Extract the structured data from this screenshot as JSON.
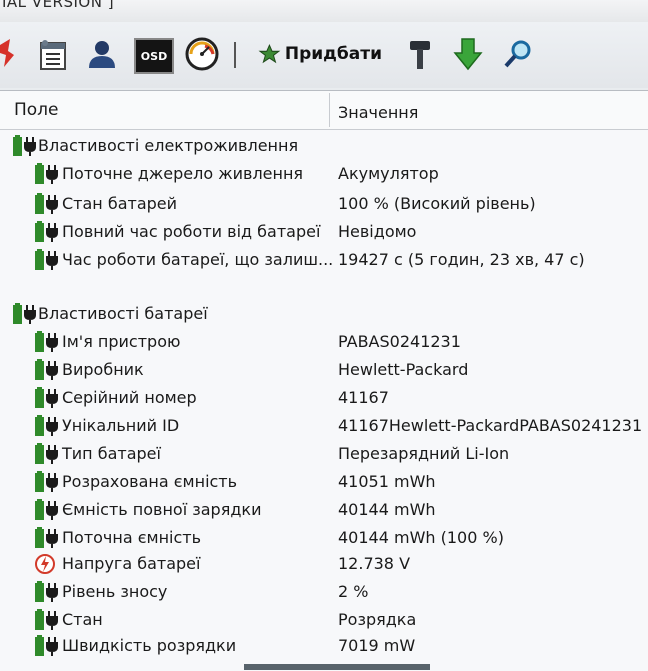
{
  "window": {
    "title": "IAL VERSION ]"
  },
  "toolbar": {
    "buy_label": "Придбати",
    "osd_label": "OSD",
    "icons": [
      "bug-icon",
      "calendar-list-icon",
      "user-icon",
      "osd-icon",
      "gauge-icon",
      "buy-star-icon",
      "hammer-icon",
      "download-arrow-icon",
      "search-icon"
    ]
  },
  "table": {
    "col_field": "Поле",
    "col_value": "Значення"
  },
  "power": {
    "title": "Властивості електроживлення",
    "rows": [
      {
        "field": "Поточне джерело живлення",
        "value": "Акумулятор"
      },
      {
        "field": "Стан батарей",
        "value": "100 % (Високий рівень)"
      },
      {
        "field": "Повний час роботи від батареї",
        "value": "Невідомо"
      },
      {
        "field": "Час роботи батареї, що залиш...",
        "value": "19427 с (5 годин, 23 хв, 47 с)"
      }
    ]
  },
  "battery": {
    "title": "Властивості батареї",
    "rows": [
      {
        "field": "Ім'я пристрою",
        "value": "PABAS0241231"
      },
      {
        "field": "Виробник",
        "value": "Hewlett-Packard"
      },
      {
        "field": "Серійний номер",
        "value": "41167"
      },
      {
        "field": "Унікальний ID",
        "value": "41167Hewlett-PackardPABAS0241231"
      },
      {
        "field": "Тип батареї",
        "value": "Перезарядний Li-Ion"
      },
      {
        "field": "Розрахована ємність",
        "value": "41051 mWh"
      },
      {
        "field": "Ємність повної зарядки",
        "value": "40144 mWh"
      },
      {
        "field": "Поточна ємність",
        "value": "40144 mWh  (100 %)"
      },
      {
        "field": "Напруга батареї",
        "value": "12.738 V"
      },
      {
        "field": "Рівень зносу",
        "value": "2 %"
      },
      {
        "field": "Стан",
        "value": "Розрядка"
      },
      {
        "field": "Швидкість розрядки",
        "value": "7019 mW"
      }
    ]
  },
  "colors": {
    "battery_green": "#2f8a2a",
    "plug_dark": "#1b1b1b",
    "arrow_green": "#3aa53a",
    "voltage_red": "#d23a2a"
  }
}
